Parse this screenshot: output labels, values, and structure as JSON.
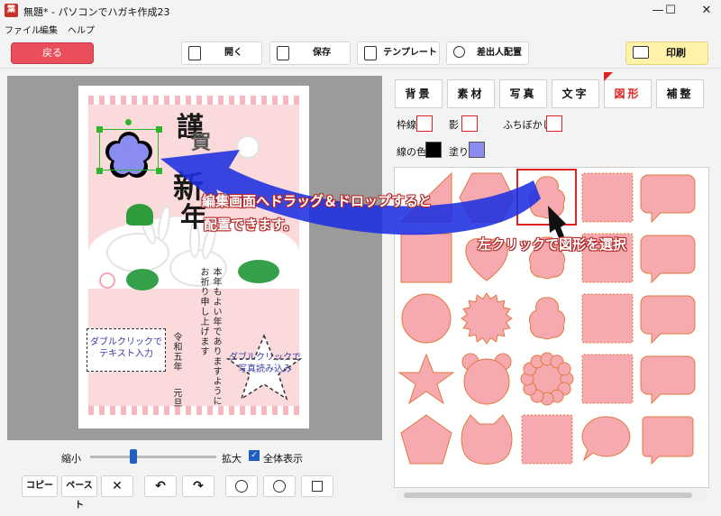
{
  "window": {
    "title": "無題* - パソコンでハガキ作成23",
    "app_icon_char": "葉",
    "minimize": "—",
    "maximize": "☐",
    "close": "✕"
  },
  "menu": [
    "ファイル",
    "編集",
    "ヘルプ"
  ],
  "toolbar": {
    "back": "戻る",
    "open": "開く",
    "save": "保存",
    "template": "テンプレート",
    "sender": "差出人配置",
    "print": "印刷"
  },
  "card": {
    "greeting": [
      "謹",
      "賀",
      "新",
      "年"
    ],
    "message": [
      "本年もよい年でありますように",
      "お祈り申し上げます"
    ],
    "date": [
      "令和五年",
      "元旦"
    ],
    "textbox": [
      "ダブルクリックで",
      "テキスト入力"
    ],
    "photo": [
      "ダブルクリックで",
      "写真読み込み"
    ]
  },
  "zoom": {
    "min_label": "縮小",
    "max_label": "拡大",
    "fit_label": "全体表示",
    "fit_checked": true,
    "level": 0.34
  },
  "edit_buttons": {
    "copy": "コピー",
    "paste": "ペースト",
    "delete": "✕",
    "undo": "↶",
    "redo": "↷"
  },
  "tabs": [
    "背景",
    "素材",
    "写真",
    "文字",
    "図形",
    "補整"
  ],
  "active_tab": "図形",
  "props": {
    "border": "枠線",
    "shadow": "影",
    "blur": "ふちぼかし",
    "line_color": "線の色",
    "fill": "塗り",
    "line_color_value": "#000000",
    "fill_color_value": "#8a8cf0"
  },
  "shape_fill": "#f6a9ae",
  "shapes": [
    "triangle",
    "hexagon",
    "flower",
    "stamp-square",
    "speech-bubble",
    "square",
    "heart",
    "flower",
    "stamp-square",
    "speech-bubble",
    "circle",
    "burst",
    "flower",
    "stamp-square",
    "speech-bubble",
    "star",
    "bear",
    "scalloped-circle",
    "stamp-square",
    "speech-bubble",
    "pentagon",
    "cat",
    "stamp-square",
    "round-bubble",
    "rect-bubble"
  ],
  "callouts": {
    "drag": [
      "編集画面へドラッグ＆ドロップすると",
      "配置できます。"
    ],
    "select": "左クリックで図形を選択"
  }
}
